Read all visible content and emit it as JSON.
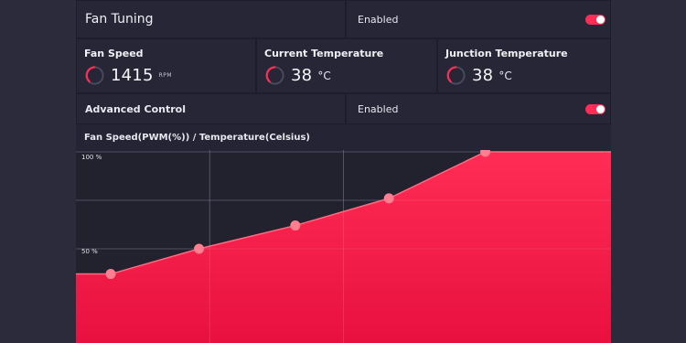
{
  "fan_tuning": {
    "title": "Fan Tuning",
    "status": "Enabled",
    "toggle_on": true
  },
  "metrics": {
    "fan_speed": {
      "title": "Fan Speed",
      "value": "1415",
      "unit": "RPM"
    },
    "current_temp": {
      "title": "Current Temperature",
      "value": "38",
      "unit": "°C"
    },
    "junction_temp": {
      "title": "Junction Temperature",
      "value": "38",
      "unit": "°C"
    }
  },
  "advanced_control": {
    "title": "Advanced Control",
    "status": "Enabled",
    "toggle_on": true
  },
  "chart_data": {
    "type": "area",
    "title": "Fan Speed(PWM(%)) / Temperature(Celsius)",
    "y_tick_labels": [
      "100 %",
      "50 %"
    ],
    "ylim": [
      0,
      100
    ],
    "grid": true,
    "points": [
      {
        "x": 0.065,
        "y": 37
      },
      {
        "x": 0.23,
        "y": 50
      },
      {
        "x": 0.41,
        "y": 62
      },
      {
        "x": 0.585,
        "y": 76
      },
      {
        "x": 0.765,
        "y": 100
      }
    ],
    "colors": {
      "fill_top": "#ff2d55",
      "fill_bottom": "#e8103f",
      "line": "#ff6a80",
      "point": "#ff7e8f"
    }
  },
  "colors": {
    "accent": "#ff2d55",
    "panel": "#262637",
    "background": "#2b2b3c"
  }
}
